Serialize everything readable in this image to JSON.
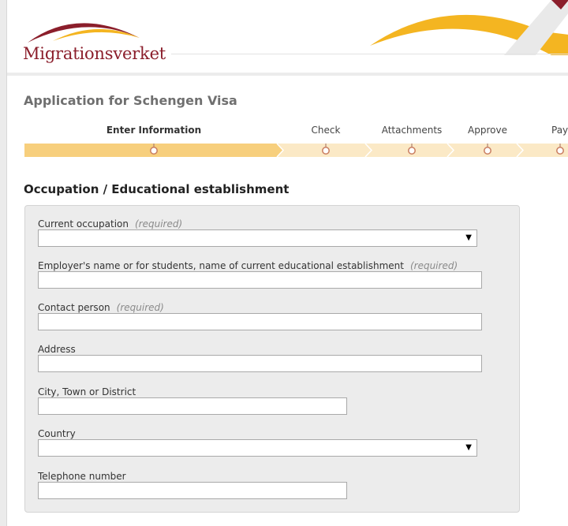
{
  "header": {
    "logo_text": "Migrationsverket",
    "brand_color": "#8b1e2b",
    "accent_color": "#f4b521"
  },
  "page": {
    "title": "Application for Schengen Visa"
  },
  "steps": [
    {
      "label": "Enter Information",
      "active": true
    },
    {
      "label": "Check",
      "active": false
    },
    {
      "label": "Attachments",
      "active": false
    },
    {
      "label": "Approve",
      "active": false
    },
    {
      "label": "Pay",
      "active": false
    }
  ],
  "section": {
    "title": "Occupation / Educational establishment"
  },
  "form": {
    "required_text": "(required)",
    "fields": {
      "current_occupation": {
        "label": "Current occupation",
        "value": ""
      },
      "employer_name": {
        "label": "Employer's name or for students, name of current educational establishment",
        "value": ""
      },
      "contact_person": {
        "label": "Contact person",
        "value": ""
      },
      "address": {
        "label": "Address",
        "value": ""
      },
      "city": {
        "label": "City, Town or District",
        "value": ""
      },
      "country": {
        "label": "Country",
        "value": ""
      },
      "telephone": {
        "label": "Telephone number",
        "value": ""
      }
    }
  }
}
